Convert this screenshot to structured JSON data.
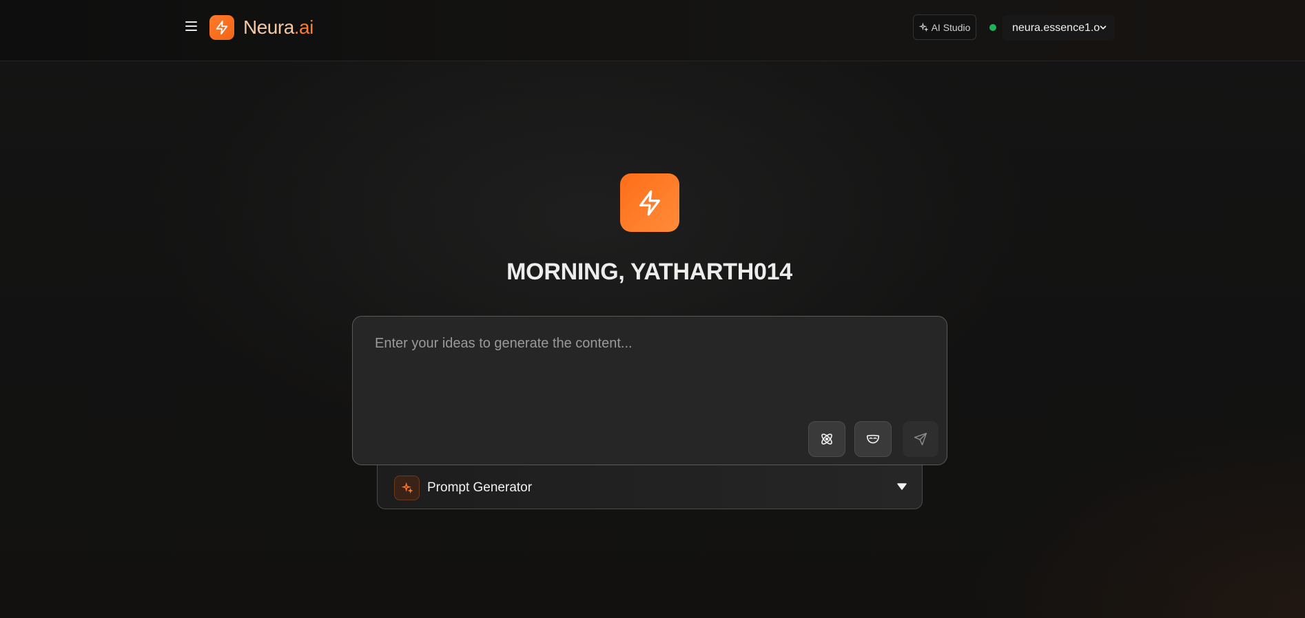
{
  "brand": {
    "name_part1": "Neura",
    "name_part2": ".ai",
    "accent_color": "#ff7a2a"
  },
  "header": {
    "menu_icon": "hamburger-menu-icon",
    "studio_label": "AI Studio",
    "studio_icon": "sparkles-icon",
    "status_color": "#1fb35a",
    "model_selected": "neura.essence1.o"
  },
  "main": {
    "hero_icon": "lightning-bolt-icon",
    "greeting": "MORNING, YATHARTH014",
    "prompt": {
      "placeholder": "Enter your ideas to generate the content...",
      "value": "",
      "tools": [
        "atom-icon",
        "mask-icon",
        "send-icon"
      ]
    },
    "generator": {
      "label": "Prompt Generator",
      "icon": "sparkles-icon"
    }
  }
}
